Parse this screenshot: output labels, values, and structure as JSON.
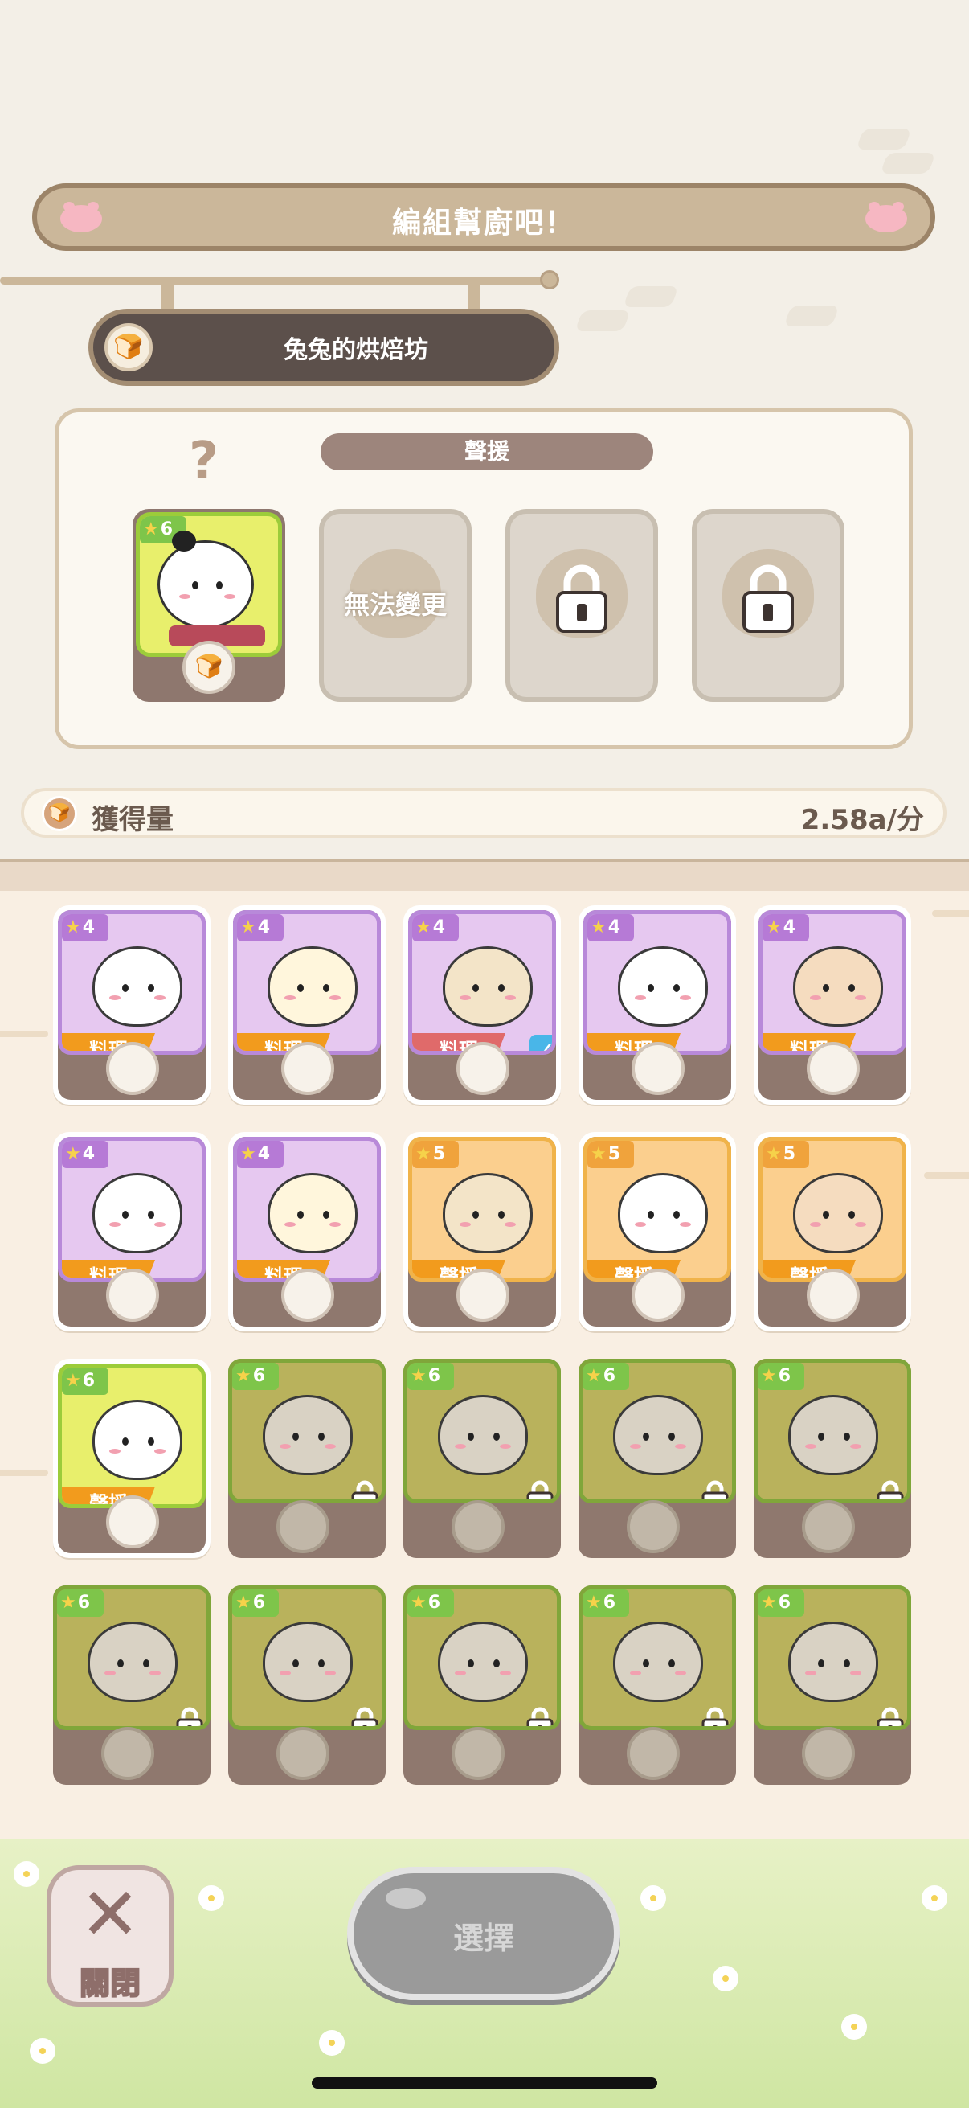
{
  "header": {
    "title": "編組幫廚吧！"
  },
  "shop": {
    "icon": "bread-icon",
    "name": "兔兔的烘焙坊"
  },
  "panel": {
    "role_label": "聲援",
    "help_icon": "question-icon",
    "chef": {
      "stars": "6"
    },
    "slot2_text": "無法變更"
  },
  "gain": {
    "label": "獲得量",
    "value": "2.58a/分"
  },
  "cards": [
    {
      "stars": "4",
      "role": "料理",
      "frame": "purple"
    },
    {
      "stars": "4",
      "role": "料理",
      "frame": "purple"
    },
    {
      "stars": "4",
      "role": "料理",
      "frame": "purple",
      "selected": true
    },
    {
      "stars": "4",
      "role": "料理",
      "frame": "purple"
    },
    {
      "stars": "4",
      "role": "料理",
      "frame": "purple"
    },
    {
      "stars": "4",
      "role": "料理",
      "frame": "purple"
    },
    {
      "stars": "4",
      "role": "料理",
      "frame": "purple"
    },
    {
      "stars": "5",
      "role": "聲援",
      "frame": "orange"
    },
    {
      "stars": "5",
      "role": "聲援",
      "frame": "orange"
    },
    {
      "stars": "5",
      "role": "聲援",
      "frame": "orange"
    },
    {
      "stars": "6",
      "role": "聲援",
      "frame": "green"
    },
    {
      "stars": "6",
      "frame": "greenlock",
      "locked": true
    },
    {
      "stars": "6",
      "frame": "greenlock",
      "locked": true
    },
    {
      "stars": "6",
      "frame": "greenlock",
      "locked": true
    },
    {
      "stars": "6",
      "frame": "greenlock",
      "locked": true
    },
    {
      "stars": "6",
      "frame": "greenlock",
      "locked": true
    },
    {
      "stars": "6",
      "frame": "greenlock",
      "locked": true
    },
    {
      "stars": "6",
      "frame": "greenlock",
      "locked": true
    },
    {
      "stars": "6",
      "frame": "greenlock",
      "locked": true
    },
    {
      "stars": "6",
      "frame": "greenlock",
      "locked": true
    }
  ],
  "bottom": {
    "close_label": "關閉",
    "select_label": "選擇"
  },
  "colors": {
    "accent": "#f29b1d",
    "selected_ribbon": "#e06a6a",
    "check": "#49b6e8",
    "bg": "#f3efe7"
  }
}
